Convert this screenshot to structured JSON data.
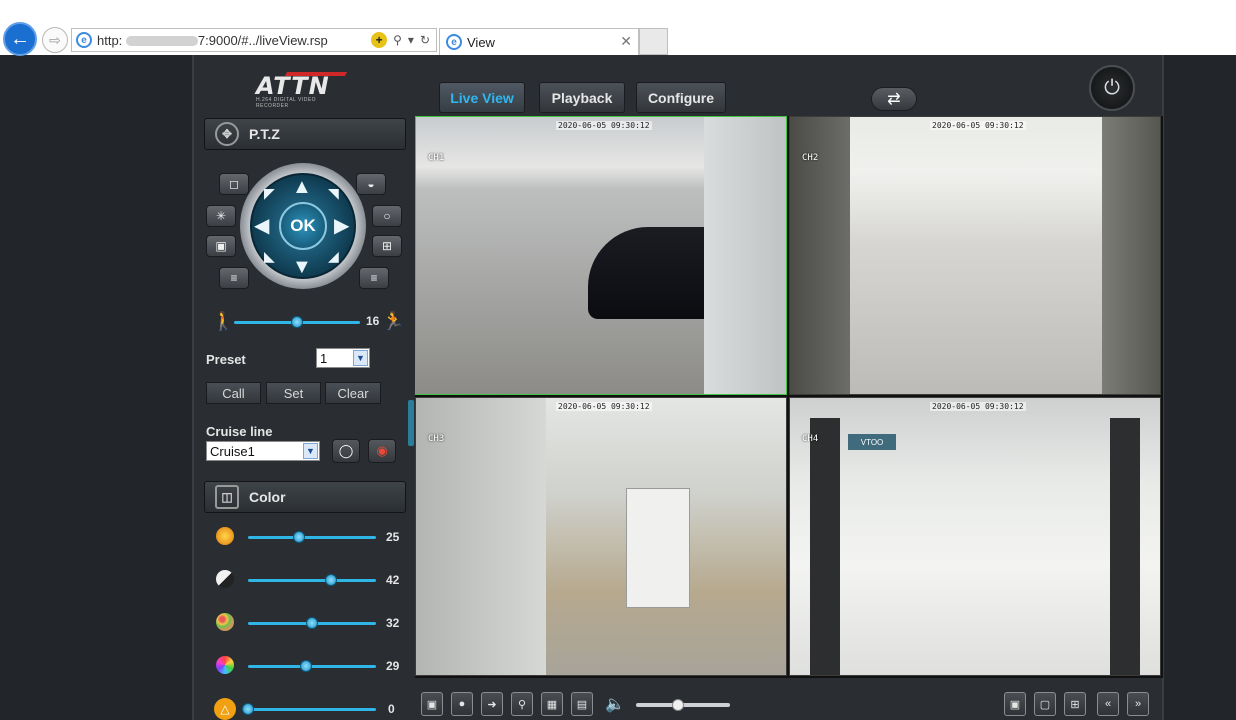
{
  "browser": {
    "url_prefix": "http:",
    "url_suffix": "7:9000/#../liveView.rsp",
    "tab_title": "View"
  },
  "app": {
    "logo": "ATTN",
    "logo_sub": "H.264 DIGITAL VIDEO RECORDER",
    "nav": [
      "Live View",
      "Playback",
      "Configure"
    ],
    "active_nav": "Live View"
  },
  "ptz": {
    "title": "P.T.Z",
    "ok_label": "OK",
    "speed_value": "16",
    "speed_level": 0.5,
    "preset_label": "Preset",
    "preset_value": "1",
    "buttons": [
      "Call",
      "Set",
      "Clear"
    ],
    "cruise_label": "Cruise line",
    "cruise_value": "Cruise1"
  },
  "color": {
    "title": "Color",
    "items": [
      {
        "icon": "brightness-icon",
        "value": "25",
        "level": 0.4
      },
      {
        "icon": "contrast-icon",
        "value": "42",
        "level": 0.65
      },
      {
        "icon": "saturation-icon",
        "value": "32",
        "level": 0.5
      },
      {
        "icon": "hue-icon",
        "value": "29",
        "level": 0.45
      },
      {
        "icon": "sharpness-icon",
        "value": "0",
        "level": 0.0
      }
    ]
  },
  "cameras": [
    {
      "label": "CH1",
      "selected": true
    },
    {
      "label": "CH2",
      "selected": false
    },
    {
      "label": "CH3",
      "selected": false
    },
    {
      "label": "CH4",
      "selected": false
    }
  ],
  "volume_level": 0.45
}
